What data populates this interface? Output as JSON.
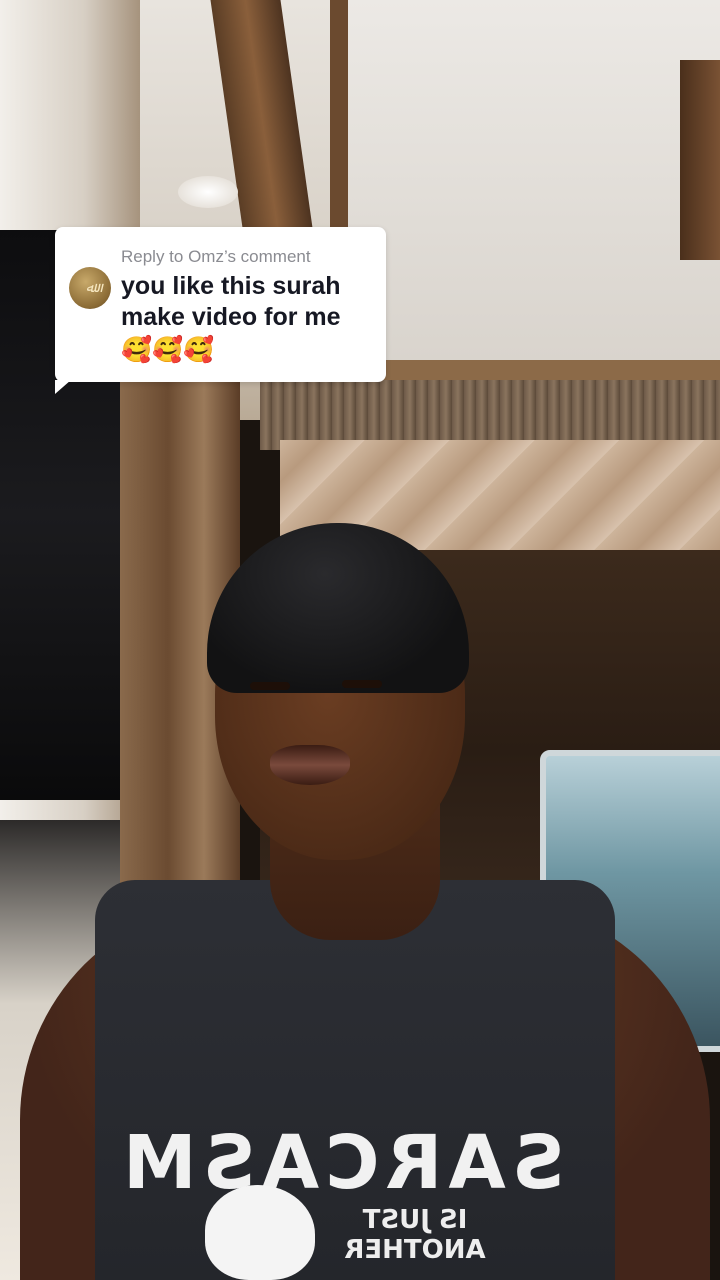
{
  "reply_comment": {
    "header": "Reply to Omz’s comment",
    "line1": "you like this surah",
    "line2": "make video for me",
    "emojis": "🥰🥰🥰",
    "avatar_icon": "avatar-icon"
  },
  "shirt": {
    "main_text": "SARCASM",
    "sub_text": "IS JUST ANOTHER"
  }
}
